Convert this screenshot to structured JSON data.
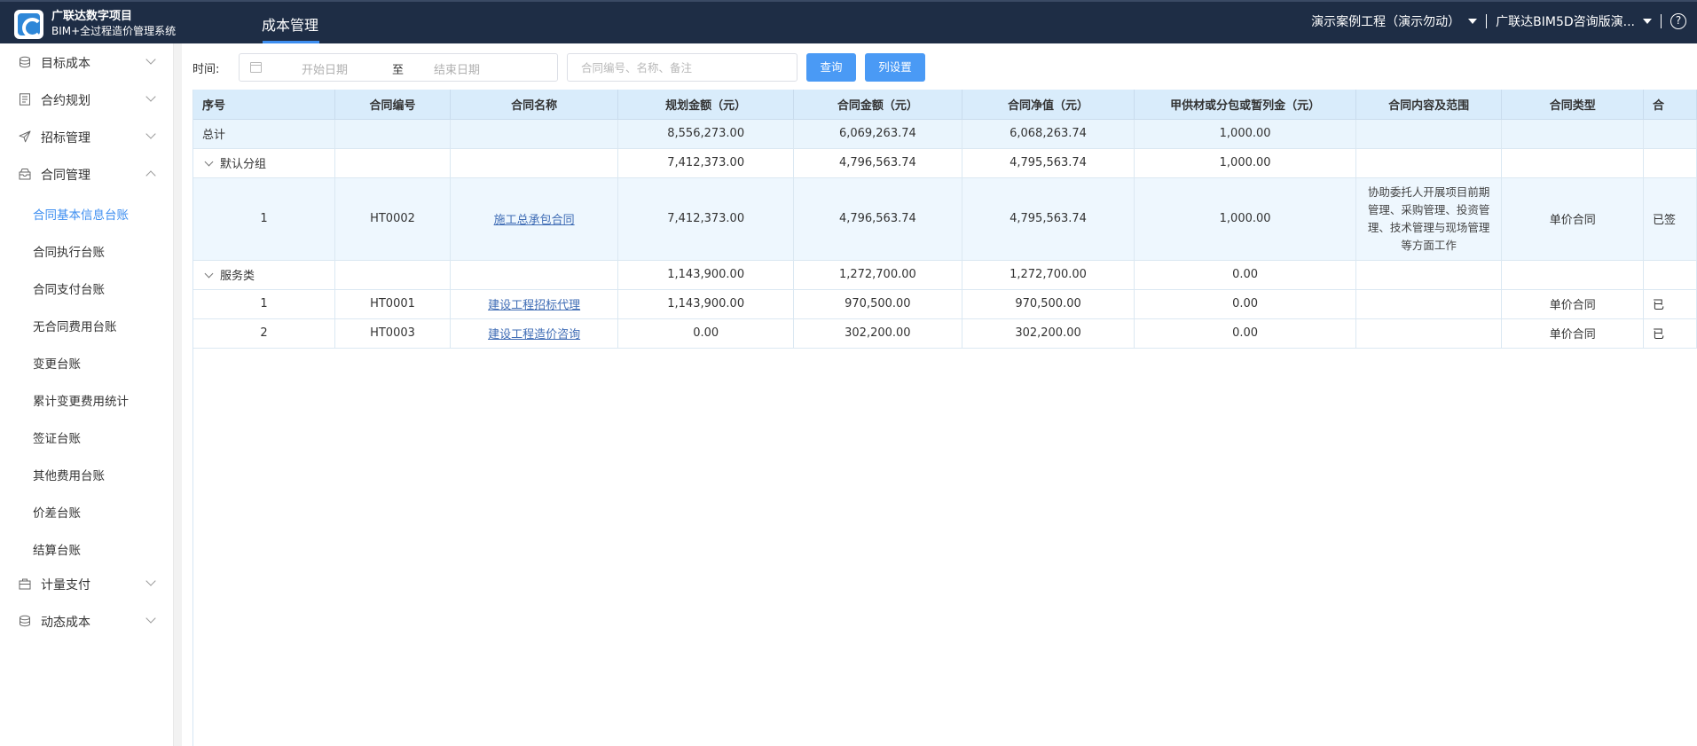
{
  "header": {
    "brand_line1": "广联达数字项目",
    "brand_line2": "BIM+全过程造价管理系统",
    "active_tab": "成本管理",
    "project_select": "演示案例工程（演示勿动）",
    "org_select": "广联达BIM5D咨询版演...",
    "help": "?"
  },
  "sidebar": {
    "groups": [
      {
        "label": "目标成本"
      },
      {
        "label": "合约规划"
      },
      {
        "label": "招标管理"
      },
      {
        "label": "合同管理"
      },
      {
        "label": "计量支付"
      },
      {
        "label": "动态成本"
      }
    ],
    "contract_items": [
      {
        "label": "合同基本信息台账",
        "active": true
      },
      {
        "label": "合同执行台账"
      },
      {
        "label": "合同支付台账"
      },
      {
        "label": "无合同费用台账"
      },
      {
        "label": "变更台账"
      },
      {
        "label": "累计变更费用统计"
      },
      {
        "label": "签证台账"
      },
      {
        "label": "其他费用台账"
      },
      {
        "label": "价差台账"
      },
      {
        "label": "结算台账"
      }
    ]
  },
  "filter": {
    "time_label": "时间:",
    "start_placeholder": "开始日期",
    "to": "至",
    "end_placeholder": "结束日期",
    "search_placeholder": "合同编号、名称、备注",
    "query_button": "查询",
    "columns_button": "列设置"
  },
  "table": {
    "headers": [
      "序号",
      "合同编号",
      "合同名称",
      "规划金额（元）",
      "合同金额（元）",
      "合同净值（元）",
      "甲供材或分包或暂列金（元）",
      "合同内容及范围",
      "合同类型",
      "合"
    ],
    "total": {
      "label": "总计",
      "planned": "8,556,273.00",
      "amount": "6,069,263.74",
      "net": "6,068,263.74",
      "supply": "1,000.00"
    },
    "groups": [
      {
        "name": "默认分组",
        "planned": "7,412,373.00",
        "amount": "4,796,563.74",
        "net": "4,795,563.74",
        "supply": "1,000.00",
        "rows": [
          {
            "no": "1",
            "code": "HT0002",
            "name": "施工总承包合同",
            "planned": "7,412,373.00",
            "amount": "4,796,563.74",
            "net": "4,795,563.74",
            "supply": "1,000.00",
            "scope": "协助委托人开展项目前期管理、采购管理、投资管理、技术管理与现场管理等方面工作",
            "type": "单价合同",
            "extra": "已签"
          }
        ]
      },
      {
        "name": "服务类",
        "planned": "1,143,900.00",
        "amount": "1,272,700.00",
        "net": "1,272,700.00",
        "supply": "0.00",
        "rows": [
          {
            "no": "1",
            "code": "HT0001",
            "name": "建设工程招标代理",
            "planned": "1,143,900.00",
            "amount": "970,500.00",
            "net": "970,500.00",
            "supply": "0.00",
            "scope": "",
            "type": "单价合同",
            "extra": "已"
          },
          {
            "no": "2",
            "code": "HT0003",
            "name": "建设工程造价咨询",
            "planned": "0.00",
            "amount": "302,200.00",
            "net": "302,200.00",
            "supply": "0.00",
            "scope": "",
            "type": "单价合同",
            "extra": "已"
          }
        ]
      }
    ]
  },
  "colors": {
    "header_bg": "#1e2d45",
    "accent": "#3d8ef0",
    "table_head": "#d9ecfb"
  }
}
